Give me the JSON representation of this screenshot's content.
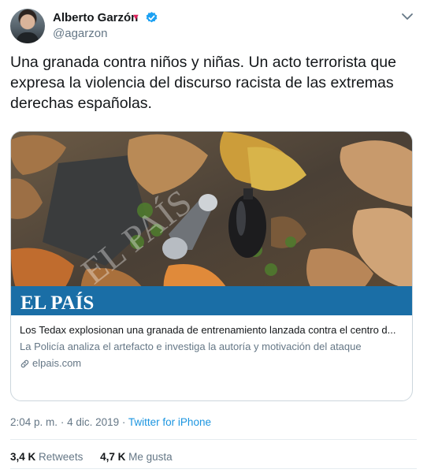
{
  "author": {
    "name": "Alberto Garzón",
    "handle": "@agarzon"
  },
  "tweet": {
    "text": "Una granada contra niños y niñas. Un acto terrorista que expresa la violencia del discurso racista de las extremas derechas españolas."
  },
  "card": {
    "image_watermark": "EL PAÍS",
    "image_brand": "EL PAÍS",
    "title": "Los Tedax explosionan una granada de entrenamiento lanzada contra el centro d...",
    "description": "La Policía analiza el artefacto e investiga la autoría y motivación del ataque",
    "domain": "elpais.com"
  },
  "meta": {
    "time": "2:04 p. m.",
    "separator": "·",
    "date": "4 dic. 2019",
    "source": "Twitter for iPhone"
  },
  "stats": {
    "retweets_count": "3,4 K",
    "retweets_label": "Retweets",
    "likes_count": "4,7 K",
    "likes_label": "Me gusta"
  },
  "colors": {
    "link_blue": "#1b95e0",
    "verified_blue": "#1da1f2",
    "heart_red": "#e0245e",
    "secondary_text": "#657786",
    "brand_band": "#1a6ea6"
  },
  "icons": [
    "heart-icon",
    "verified-icon",
    "chevron-down-icon",
    "link-icon"
  ]
}
